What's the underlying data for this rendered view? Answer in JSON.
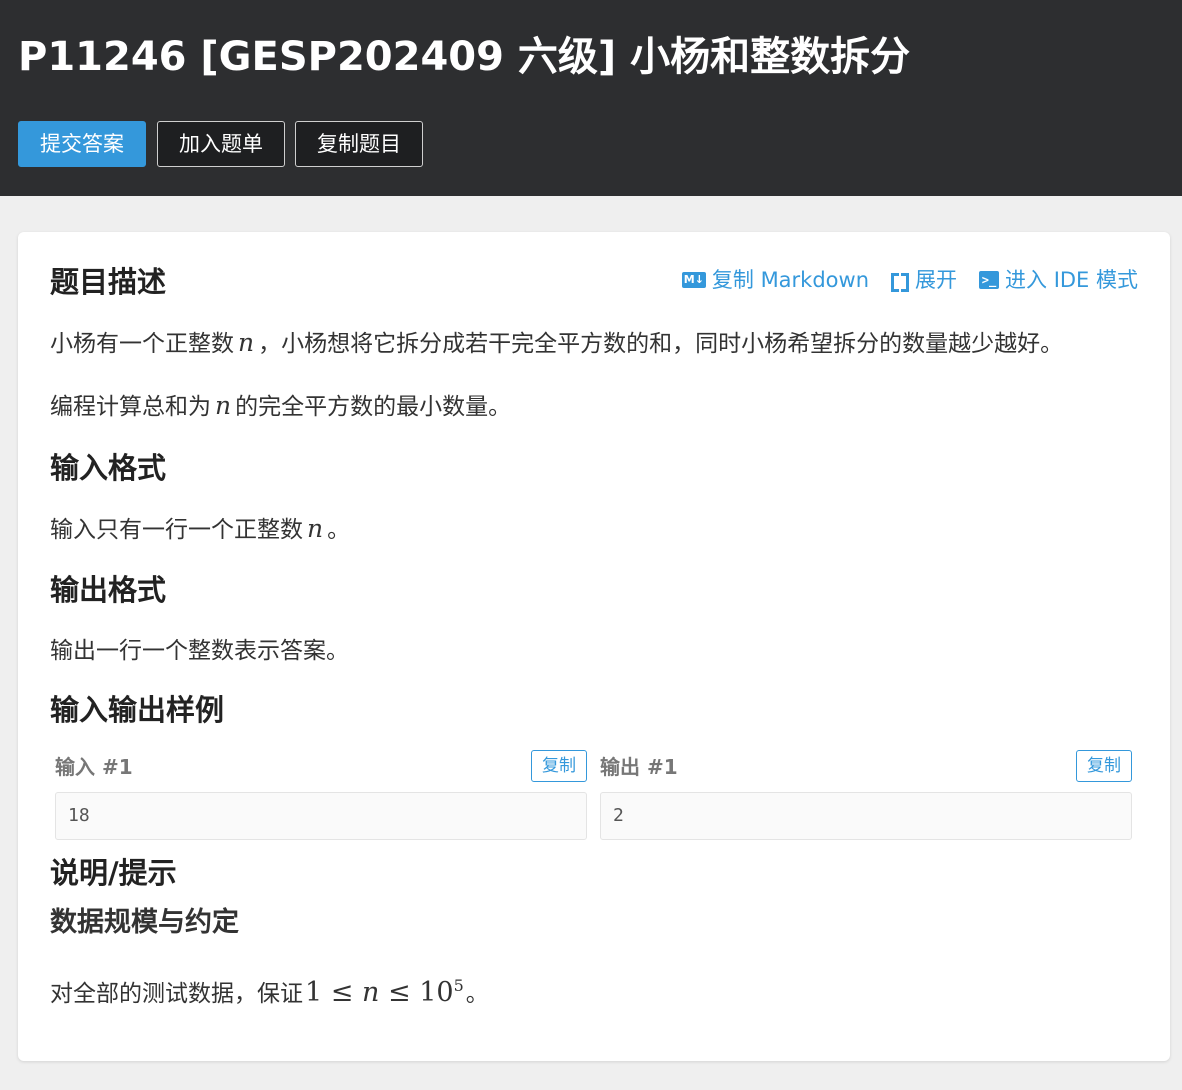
{
  "header": {
    "title": "P11246 [GESP202409 六级] 小杨和整数拆分",
    "buttons": {
      "submit": "提交答案",
      "add_to_list": "加入题单",
      "copy_problem": "复制题目"
    }
  },
  "toolbar": {
    "copy_markdown": "复制 Markdown",
    "expand": "展开",
    "ide_mode": "进入 IDE 模式"
  },
  "description": {
    "heading": "题目描述",
    "p1_before": "小杨有一个正整数",
    "p1_var": "n",
    "p1_after": "，小杨想将它拆分成若干完全平方数的和，同时小杨希望拆分的数量越少越好。",
    "p2_before": "编程计算总和为",
    "p2_var": "n",
    "p2_after": "的完全平方数的最小数量。"
  },
  "input_format": {
    "heading": "输入格式",
    "text_before": "输入只有一行一个正整数",
    "text_var": "n",
    "text_after": "。"
  },
  "output_format": {
    "heading": "输出格式",
    "text": "输出一行一个整数表示答案。"
  },
  "samples": {
    "heading": "输入输出样例",
    "input_label": "输入 #1",
    "output_label": "输出 #1",
    "copy_label": "复制",
    "input_value": "18",
    "output_value": "2"
  },
  "hint": {
    "heading": "说明/提示",
    "subheading": "数据规模与约定",
    "text_before": "对全部的测试数据，保证",
    "math_one": "1",
    "math_le1": "≤",
    "math_n": "n",
    "math_le2": "≤",
    "math_base": "10",
    "math_exp": "5",
    "text_after": "。"
  },
  "icons": {
    "markdown": "markdown-icon",
    "expand": "expand-icon",
    "terminal": "terminal-icon"
  },
  "colors": {
    "header_bg": "#2d2e30",
    "accent": "#3498db",
    "page_bg": "#efefef"
  }
}
